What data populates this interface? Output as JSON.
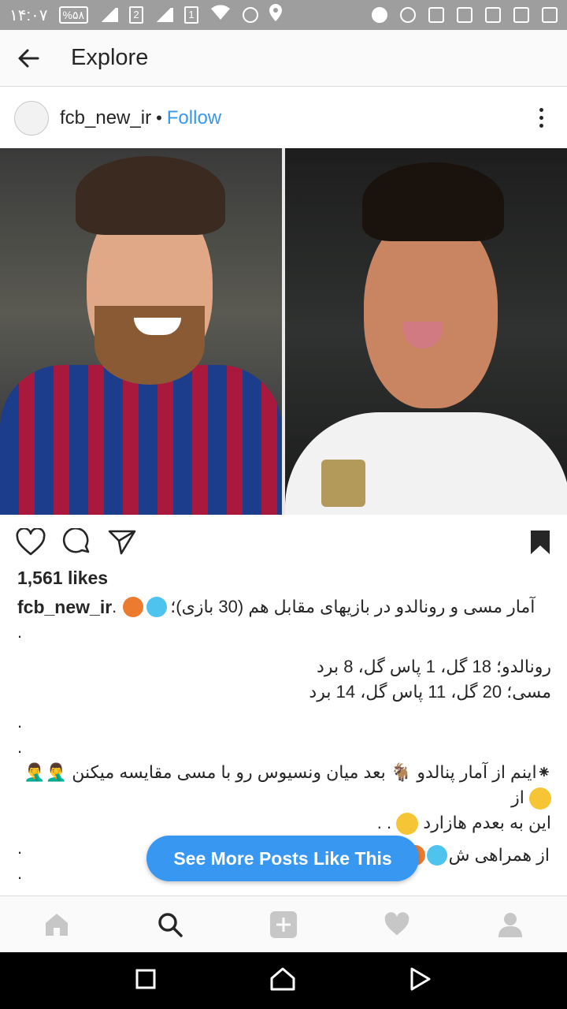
{
  "status_bar": {
    "time": "۱۴:۰۷",
    "battery": "%۵۸",
    "sim1": "2",
    "sim2": "1"
  },
  "header": {
    "title": "Explore",
    "back_icon": "arrow-left-icon"
  },
  "post": {
    "username": "fcb_new_ir",
    "separator": "•",
    "follow_label": "Follow",
    "likes": "1,561 likes",
    "caption": {
      "username": "fcb_new_ir",
      "first_line": "آمار مسی و رونالدو در بازیهای مقابل هم (30 بازی)؛",
      "first_line_tail": " .",
      "dot": ".",
      "ronaldo_line": "رونالدو؛ 18 گل، 1 پاس گل، 8 برد",
      "messi_line": "مسی؛ 20 گل، 11 پاس گل، 14 برد",
      "star_line_1": "⁕اینم از آمار پنالدو 🐐 بعد میان ونسیوس رو با مسی مقایسه میکنن 🤦‍♂️🤦‍♂️",
      "star_line_1_end": "از",
      "star_line_2": "این به بعدم هازارد",
      "star_line_2_end": ". .",
      "trail_text": "از همراهی ش"
    }
  },
  "see_more_label": "See More Posts Like This",
  "colors": {
    "accent": "#3897f0",
    "text": "#262626",
    "status_bar": "#9e9e9e",
    "emoji_orange": "#ed7b2f",
    "emoji_blue": "#4dc3ed"
  },
  "bottom_nav": [
    "home-icon",
    "search-icon",
    "add-icon",
    "heart-icon",
    "profile-icon"
  ],
  "system_nav": [
    "recents-icon",
    "home-icon",
    "back-icon"
  ]
}
